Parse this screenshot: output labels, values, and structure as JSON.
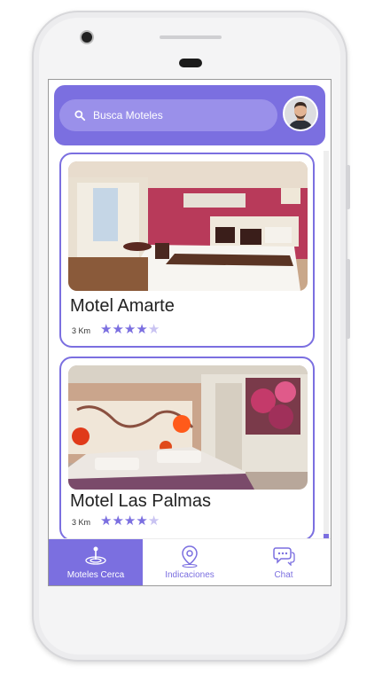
{
  "search": {
    "placeholder": "Busca Moteles"
  },
  "motels": [
    {
      "name": "Motel Amarte",
      "distance": "3 Km",
      "rating": 4
    },
    {
      "name": "Motel Las Palmas",
      "distance": "3 Km",
      "rating": 4
    }
  ],
  "nav": [
    {
      "label": "Moteles Cerca",
      "icon": "nearby-icon",
      "active": true
    },
    {
      "label": "Indicaciones",
      "icon": "location-pin-icon",
      "active": false
    },
    {
      "label": "Chat",
      "icon": "chat-icon",
      "active": false
    }
  ],
  "colors": {
    "accent": "#7b6fe0",
    "accent_light": "#9a90ea"
  }
}
